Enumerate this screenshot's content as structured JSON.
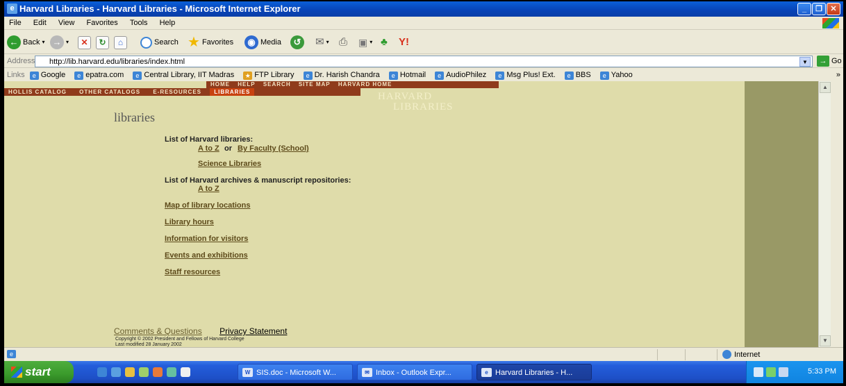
{
  "window": {
    "title": "Harvard Libraries - Harvard Libraries - Microsoft Internet Explorer"
  },
  "menu": [
    "File",
    "Edit",
    "View",
    "Favorites",
    "Tools",
    "Help"
  ],
  "toolbar": {
    "back": "Back",
    "search": "Search",
    "favorites": "Favorites",
    "media": "Media"
  },
  "address": {
    "label": "Address",
    "url": "http://lib.harvard.edu/libraries/index.html",
    "go": "Go"
  },
  "links": {
    "label": "Links",
    "items": [
      "Google",
      "epatra.com",
      "Central Library, IIT Madras",
      "FTP Library",
      "Dr. Harish Chandra",
      "Hotmail",
      "AudioPhilez",
      "Msg Plus! Ext.",
      "BBS",
      "Yahoo"
    ],
    "more": "»"
  },
  "site": {
    "topnav": [
      "HOME",
      "HELP",
      "SEARCH",
      "SITE MAP",
      "HARVARD HOME"
    ],
    "catnav": [
      "HOLLIS CATALOG",
      "OTHER CATALOGS",
      "E-RESOURCES",
      "LIBRARIES"
    ],
    "logo": {
      "line1": "HARVARD",
      "line2": "LIBRARIES"
    },
    "title": "libraries",
    "list_header": "List of Harvard libraries:",
    "az": "A to Z",
    "or": "or",
    "by_faculty": "By Faculty (School)",
    "science": "Science Libraries",
    "archives_header": "List of Harvard archives & manuscript repositories:",
    "archives_az": "A to Z",
    "map": "Map of library locations",
    "hours": "Library hours",
    "visitors": "Information for visitors",
    "events": "Events and exhibitions",
    "staff": "Staff resources",
    "comments": "Comments & Questions",
    "privacy": "Privacy Statement",
    "copyright": "Copyright © 2002 President and Fellows of Harvard College",
    "modified": "Last modified 28 January 2002"
  },
  "status": {
    "zone": "Internet"
  },
  "taskbar": {
    "start": "start",
    "tasks": [
      "SIS.doc - Microsoft W...",
      "Inbox - Outlook Expr...",
      "Harvard Libraries - H..."
    ],
    "clock": "5:33 PM"
  },
  "colors": {
    "page_bg": "#dfdcaa",
    "side_bg": "#999966",
    "nav_bg": "#8f3b1b",
    "active_tab": "#c8420f"
  }
}
